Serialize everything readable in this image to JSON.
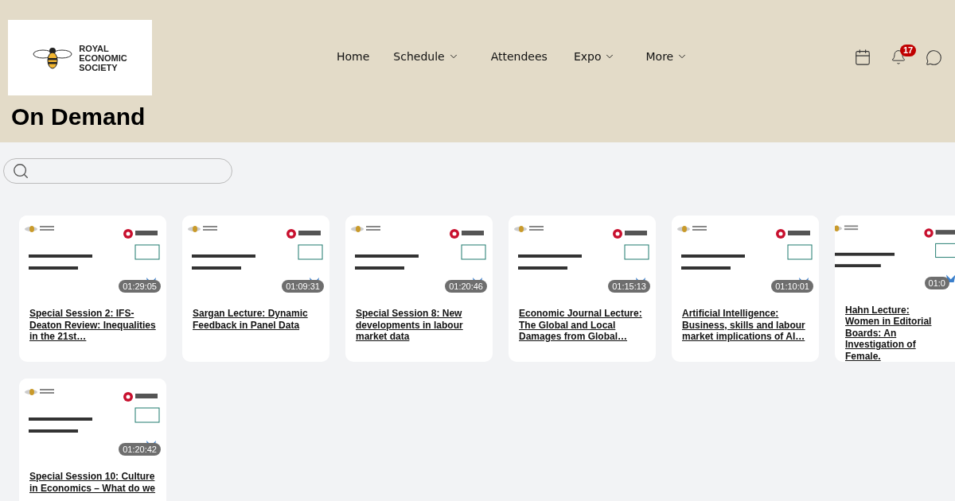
{
  "header": {
    "logo": {
      "lines": [
        "ROYAL",
        "ECONOMIC",
        "SOCIETY"
      ]
    },
    "nav": [
      {
        "label": "Home",
        "dropdown": false
      },
      {
        "label": "Schedule",
        "dropdown": true
      },
      {
        "label": "Attendees",
        "dropdown": false
      },
      {
        "label": "Expo",
        "dropdown": true
      },
      {
        "label": "More",
        "dropdown": true
      }
    ],
    "notification_count": "17",
    "page_title": "On Demand"
  },
  "sessions": [
    {
      "duration": "01:29:05",
      "title": "Special Session 2: IFS-Deaton Review: Inequalities in the 21st…"
    },
    {
      "duration": "01:09:31",
      "title": "Sargan Lecture: Dynamic Feedback in Panel Data"
    },
    {
      "duration": "01:20:46",
      "title": "Special Session 8: New developments in labour market data"
    },
    {
      "duration": "01:15:13",
      "title": "Economic Journal Lecture: The Global and Local Damages from Global…"
    },
    {
      "duration": "01:10:01",
      "title": "Artificial Intelligence: Business, skills and labour market implications of AI…"
    },
    {
      "duration": "01:0",
      "title": "Hahn Lecture: Women in Editorial Boards: An Investigation of Female."
    },
    {
      "duration": "01:20:42",
      "title": "Special Session 10: Culture in Economics – What do we"
    }
  ]
}
